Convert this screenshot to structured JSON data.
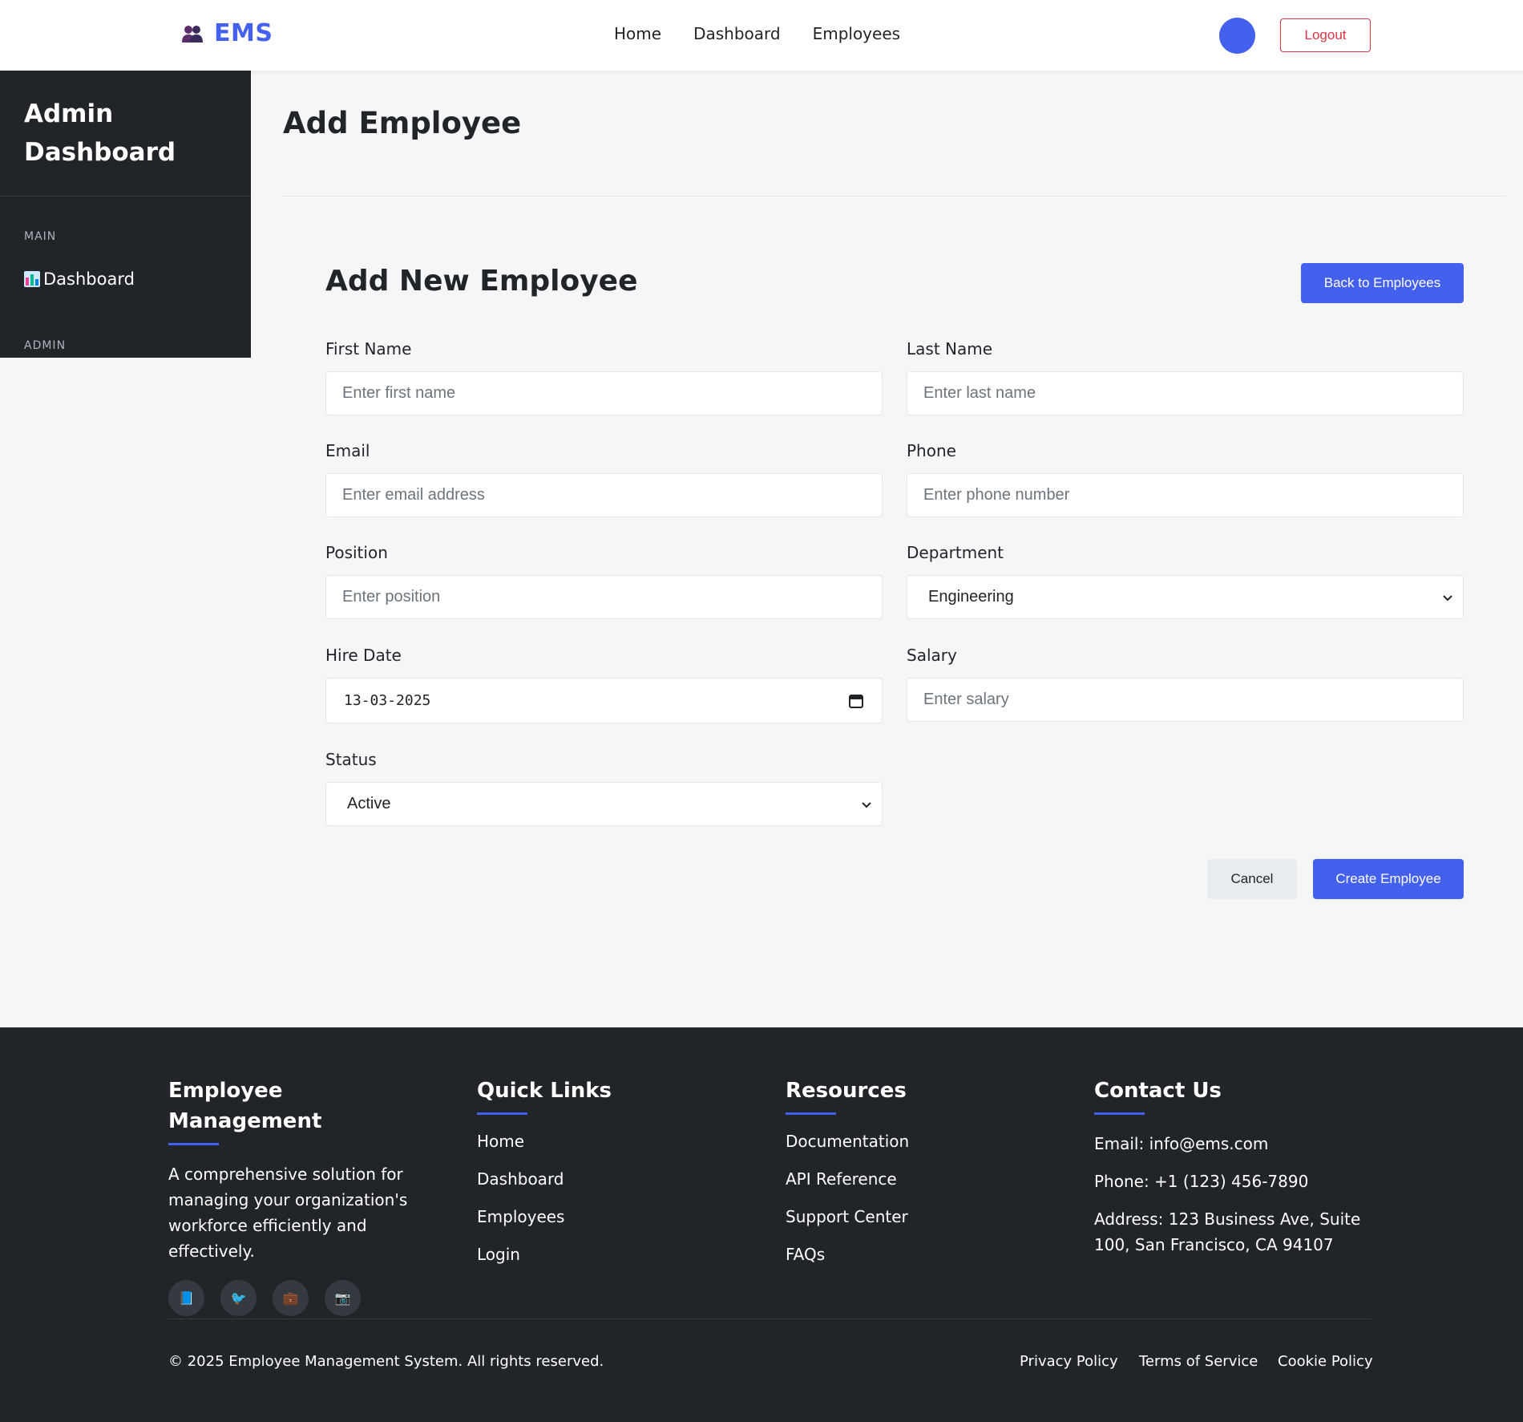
{
  "navbar": {
    "brand": "EMS",
    "links": [
      "Home",
      "Dashboard",
      "Employees"
    ],
    "logout": "Logout"
  },
  "sidebar": {
    "title_line1": "Admin",
    "title_line2": "Dashboard",
    "section_main": "MAIN",
    "item_dashboard": "Dashboard",
    "section_admin": "ADMIN"
  },
  "main": {
    "page_title": "Add Employee",
    "form_heading": "Add New Employee",
    "back_button": "Back to Employees",
    "fields": {
      "first_name": {
        "label": "First Name",
        "placeholder": "Enter first name"
      },
      "last_name": {
        "label": "Last Name",
        "placeholder": "Enter last name"
      },
      "email": {
        "label": "Email",
        "placeholder": "Enter email address"
      },
      "phone": {
        "label": "Phone",
        "placeholder": "Enter phone number"
      },
      "position": {
        "label": "Position",
        "placeholder": "Enter position"
      },
      "department": {
        "label": "Department",
        "value": "Engineering"
      },
      "hire_date": {
        "label": "Hire Date",
        "value": "13-03-2025"
      },
      "salary": {
        "label": "Salary",
        "placeholder": "Enter salary"
      },
      "status": {
        "label": "Status",
        "value": "Active"
      }
    },
    "cancel_button": "Cancel",
    "create_button": "Create Employee"
  },
  "footer": {
    "about": {
      "heading": "Employee Management",
      "text": "A comprehensive solution for managing your organization's workforce efficiently and effectively.",
      "socials": [
        "📘",
        "🐦",
        "💼",
        "📷"
      ]
    },
    "quick_links": {
      "heading": "Quick Links",
      "items": [
        "Home",
        "Dashboard",
        "Employees",
        "Login"
      ]
    },
    "resources": {
      "heading": "Resources",
      "items": [
        "Documentation",
        "API Reference",
        "Support Center",
        "FAQs"
      ]
    },
    "contact": {
      "heading": "Contact Us",
      "email": "Email: info@ems.com",
      "phone": "Phone: +1 (123) 456-7890",
      "address": "Address: 123 Business Ave, Suite 100, San Francisco, CA 94107"
    },
    "copyright": "© 2025 Employee Management System. All rights reserved.",
    "legal": [
      "Privacy Policy",
      "Terms of Service",
      "Cookie Policy"
    ]
  },
  "colors": {
    "primary": "#4361ee",
    "danger": "#dc3545",
    "dark": "#212529",
    "page_bg": "#f5f6f8"
  }
}
